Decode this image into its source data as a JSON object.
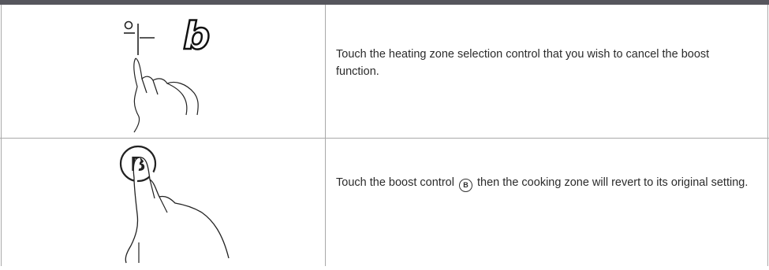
{
  "steps": [
    {
      "illustration": "finger-touching-zone-selection-icon",
      "display_symbol": "b",
      "text": "Touch the heating zone selection control that you wish to cancel the boost function."
    },
    {
      "illustration": "finger-touching-boost-button-icon",
      "button_label": "B",
      "text_before": "Touch the boost control",
      "inline_symbol": "B",
      "text_after": "then the cooking zone will revert to its original setting."
    }
  ]
}
